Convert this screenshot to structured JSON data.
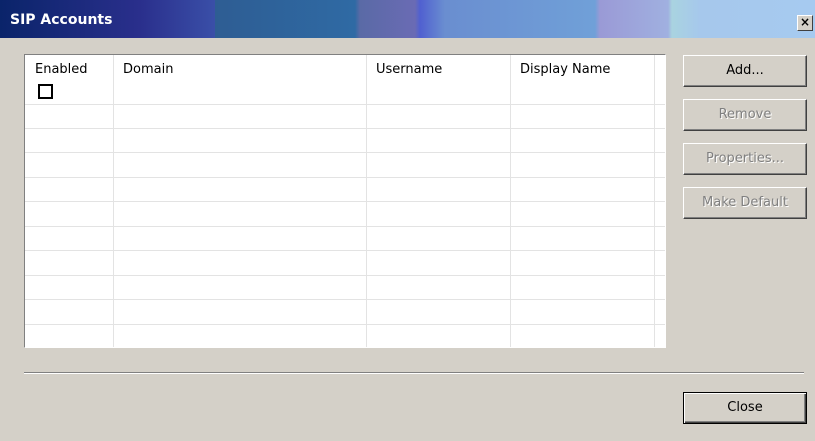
{
  "window": {
    "title": "SIP Accounts",
    "close_glyph": "×"
  },
  "table": {
    "columns": [
      "Enabled",
      "Domain",
      "Username",
      "Display Name"
    ],
    "rows": [
      {
        "enabled": false,
        "domain": "",
        "username": "",
        "display_name": ""
      }
    ]
  },
  "buttons": {
    "add": {
      "label": "Add...",
      "enabled": true
    },
    "remove": {
      "label": "Remove",
      "enabled": false
    },
    "properties": {
      "label": "Properties...",
      "enabled": false
    },
    "make_default": {
      "label": "Make Default",
      "enabled": false
    },
    "close": {
      "label": "Close",
      "enabled": true
    }
  },
  "colors": {
    "dialog_bg": "#d4d0c8",
    "title_text": "#ffffff",
    "disabled_text": "#808080"
  }
}
